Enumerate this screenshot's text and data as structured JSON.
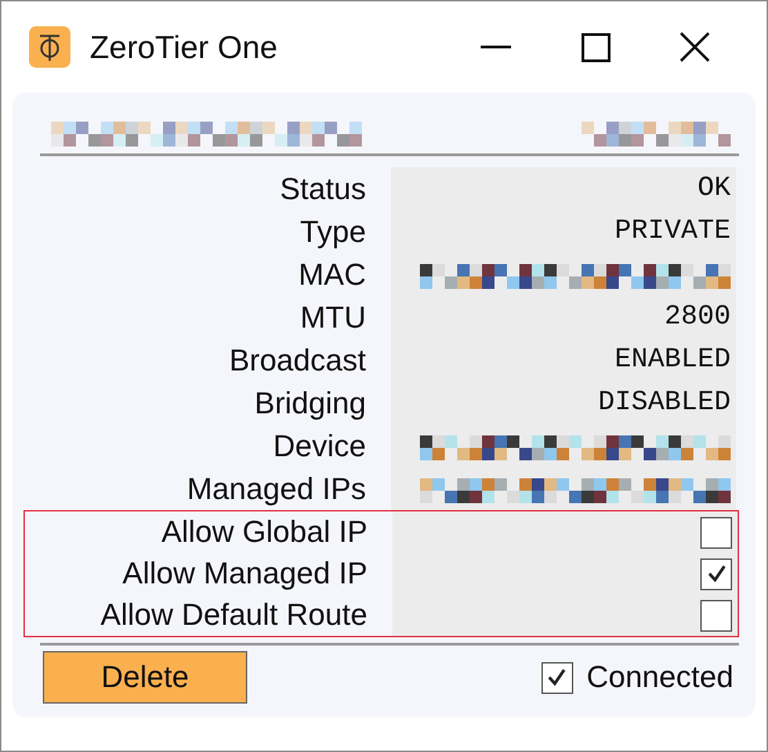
{
  "window": {
    "title": "ZeroTier One"
  },
  "properties": [
    {
      "label": "Status",
      "kind": "text",
      "value": "OK"
    },
    {
      "label": "Type",
      "kind": "text",
      "value": "PRIVATE"
    },
    {
      "label": "MAC",
      "kind": "redacted"
    },
    {
      "label": "MTU",
      "kind": "text",
      "value": "2800"
    },
    {
      "label": "Broadcast",
      "kind": "text",
      "value": "ENABLED"
    },
    {
      "label": "Bridging",
      "kind": "text",
      "value": "DISABLED"
    },
    {
      "label": "Device",
      "kind": "redacted"
    },
    {
      "label": "Managed IPs",
      "kind": "redacted"
    }
  ],
  "options": {
    "highlighted": true,
    "items": [
      {
        "label": "Allow Global IP",
        "checked": false
      },
      {
        "label": "Allow Managed IP",
        "checked": true
      },
      {
        "label": "Allow Default Route",
        "checked": false
      }
    ]
  },
  "footer": {
    "delete_button": "Delete",
    "connected": {
      "label": "Connected",
      "checked": true
    }
  }
}
